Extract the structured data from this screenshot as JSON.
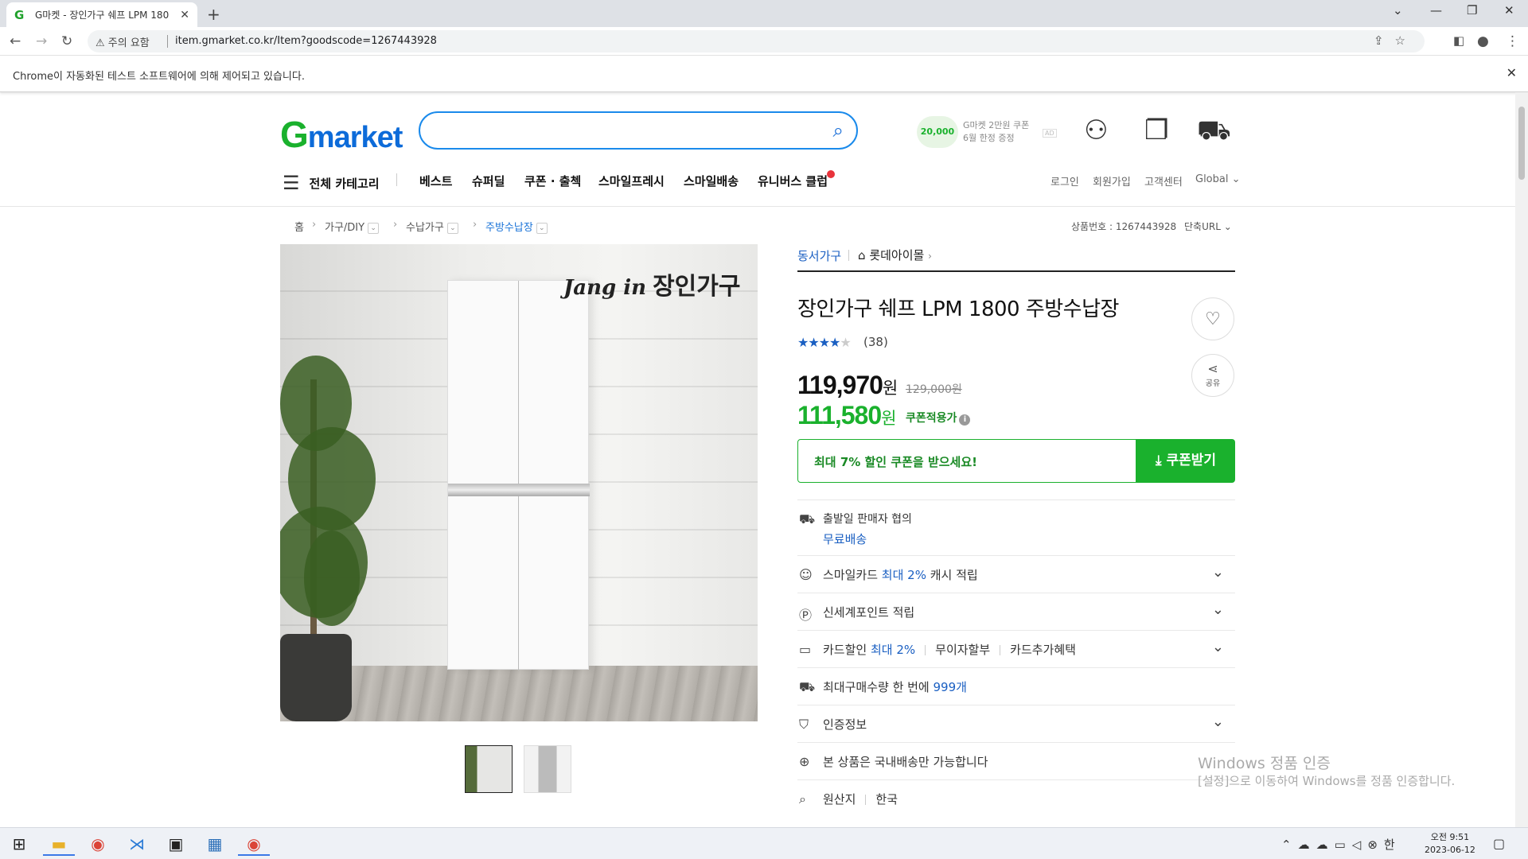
{
  "browser": {
    "tab_title": "G마켓 - 장인가구 쉐프 LPM 180",
    "tab_favicon": "G",
    "security_label": "주의 요함",
    "url": "item.gmarket.co.kr/Item?goodscode=1267443928",
    "automation_notice": "Chrome이 자동화된 테스트 소프트웨어에 의해 제어되고 있습니다."
  },
  "header": {
    "logo_g": "G",
    "logo_rest": "market",
    "search_placeholder": "",
    "promo_coin": "20,000",
    "promo_line1": "G마켓 2만원 쿠폰",
    "promo_line2": "6월 한정 증정",
    "promo_ad": "AD",
    "all_categories": "전체 카테고리",
    "nav": [
      "베스트",
      "슈퍼딜",
      "쿠폰 · 출첵",
      "스마일프레시",
      "스마일배송",
      "유니버스 클럽"
    ],
    "util": [
      "로그인",
      "회원가입",
      "고객센터",
      "Global"
    ]
  },
  "breadcrumb": {
    "items": [
      "홈",
      "가구/DIY",
      "수납가구",
      "주방수납장"
    ],
    "product_number": "상품번호 : 1267443928",
    "short_url": "단축URL"
  },
  "image": {
    "brand_script": "Jang in",
    "brand_text": "장인가구"
  },
  "product": {
    "seller": "동서가구",
    "store": "롯데아이몰",
    "title": "장인가구 쉐프 LPM 1800 주방수납장",
    "rating": 4,
    "rating_stars_filled": "★★★★",
    "rating_stars_empty": "★",
    "review_count": "(38)",
    "price": "119,970",
    "price_unit": "원",
    "original_price": "129,000원",
    "coupon_price": "111,580",
    "coupon_price_label": "쿠폰적용가",
    "coupon_banner": "최대 7% 할인 쿠폰을 받으세요!",
    "coupon_button": "쿠폰받기",
    "share_label": "공유"
  },
  "info_rows": [
    {
      "text": "출발일 판매자 협의",
      "sub": "무료배송"
    },
    {
      "pre": "스마일카드 ",
      "blue": "최대 2%",
      "post": " 캐시 적립"
    },
    {
      "text": "신세계포인트 적립"
    },
    {
      "pre": "카드할인 ",
      "blue": "최대 2%",
      "extra1": "무이자할부",
      "extra2": "카드추가혜택"
    },
    {
      "pre": "최대구매수량 한 번에 ",
      "blue": "999개"
    },
    {
      "text": "인증정보"
    },
    {
      "text": "본 상품은 국내배송만 가능합니다"
    },
    {
      "pre": "원산지",
      "extra1": "한국"
    }
  ],
  "watermark": {
    "line1": "Windows 정품 인증",
    "line2": "[설정]으로 이동하여 Windows를 정품 인증합니다."
  },
  "taskbar": {
    "ime": "한",
    "time": "오전 9:51",
    "date": "2023-06-12"
  }
}
